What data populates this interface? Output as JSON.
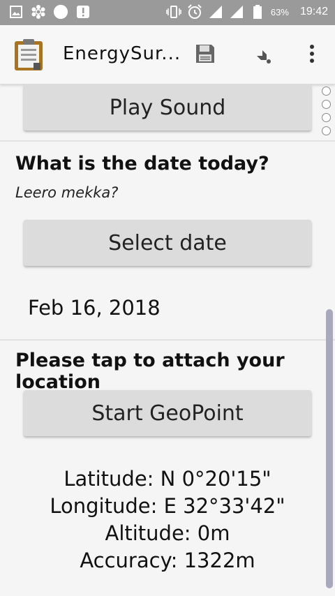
{
  "status_bar": {
    "battery": "63%",
    "time": "19:42",
    "icons": [
      "image-icon",
      "settings-flower-icon",
      "circle-icon",
      "alert-icon",
      "vibrate-icon",
      "alarm-icon",
      "signal-icon",
      "signal-icon",
      "battery-icon"
    ]
  },
  "app_bar": {
    "title": "EnergySur...",
    "icons": [
      "clipboard-icon",
      "save-icon",
      "jump-arrow-icon",
      "more-vert-icon"
    ]
  },
  "content": {
    "play_sound_label": "Play Sound",
    "date_question": "What is the date today?",
    "date_hint": "Leero mekka?",
    "select_date_label": "Select date",
    "date_value": "Feb 16, 2018",
    "location_question": "Please tap to attach your location",
    "geopoint_label": "Start GeoPoint",
    "latitude": "Latitude: N 0°20'15\"",
    "longitude": "Longitude: E 32°33'42\"",
    "altitude": "Altitude: 0m",
    "accuracy": "Accuracy: 1322m"
  },
  "colors": {
    "status_bar_bg": "#9a9a9a",
    "button_bg": "#dcdcdc",
    "background": "#f5f5f5",
    "scrollbar": "#a9a9bd"
  }
}
